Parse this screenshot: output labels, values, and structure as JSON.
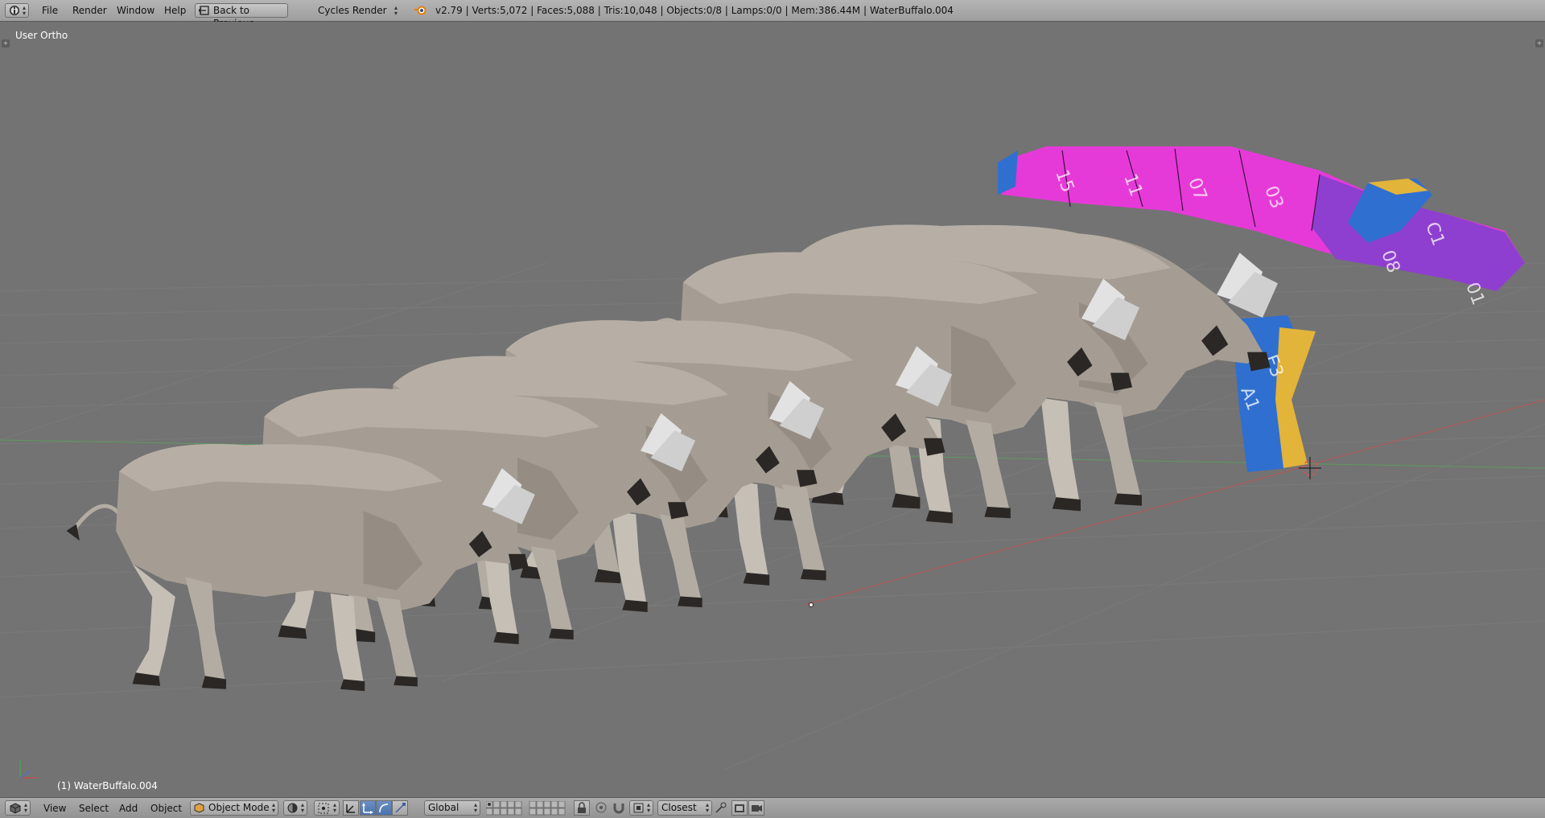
{
  "topbar": {
    "menus": [
      "File",
      "Render",
      "Window",
      "Help"
    ],
    "back_button": "Back to Previous",
    "engine": "Cycles Render",
    "stats": "v2.79 | Verts:5,072 | Faces:5,088 | Tris:10,048 | Objects:0/8 | Lamps:0/0 | Mem:386.44M | WaterBuffalo.004"
  },
  "viewport": {
    "view_label": "User Ortho",
    "object_label": "(1) WaterBuffalo.004",
    "uv_labels": [
      "15",
      "11",
      "07",
      "03",
      "C1",
      "08",
      "E3",
      "A1",
      "01"
    ]
  },
  "bottombar": {
    "menus": [
      "View",
      "Select",
      "Add",
      "Object"
    ],
    "mode": "Object Mode",
    "orientation": "Global",
    "snap": "Closest"
  },
  "colors": {
    "header_bg": "#a8a8a8",
    "viewport_bg": "#737373",
    "buffalo_body": "#a59d93",
    "horn": "#e2e2e2",
    "uv_magenta": "#e63ad8",
    "uv_purple": "#8e3fcf",
    "uv_blue": "#2f6fd0",
    "uv_yellow": "#e3b43a",
    "active_button": "#5a7fb8"
  },
  "icons": [
    "info-icon",
    "back-icon",
    "blender-logo-icon",
    "mesh-cube-icon",
    "viewport-shading-icon",
    "pivot-icon",
    "manipulator-icon",
    "translate-icon",
    "rotate-icon",
    "scale-icon",
    "layers-icon",
    "lock-icon",
    "snap-magnet-icon",
    "snap-target-icon",
    "render-icon",
    "camera-icon"
  ]
}
